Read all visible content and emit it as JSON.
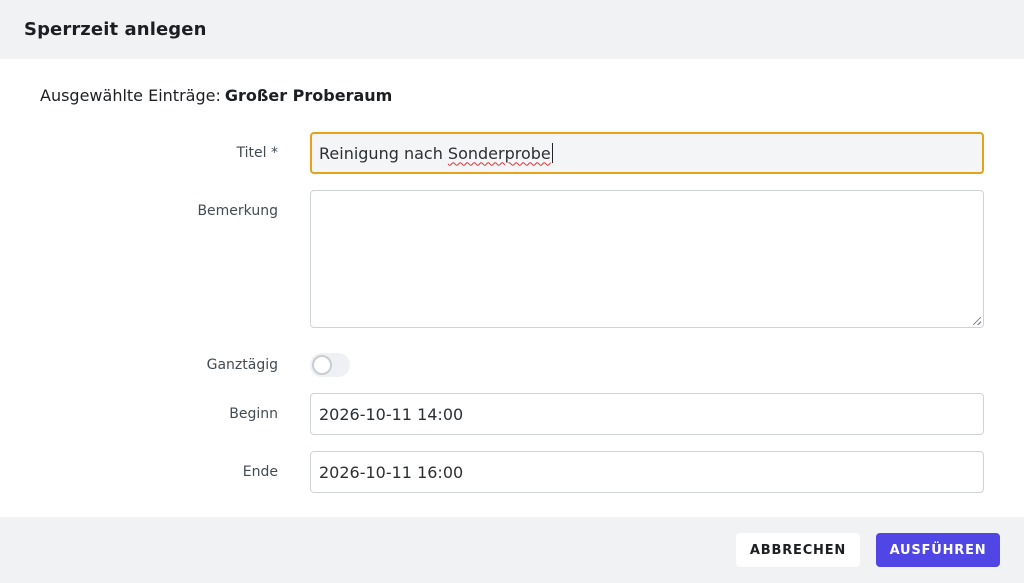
{
  "dialog": {
    "title": "Sperrzeit anlegen"
  },
  "selection": {
    "label": "Ausgewählte Einträge:",
    "value": "Großer Proberaum"
  },
  "form": {
    "title": {
      "label": "Titel *",
      "value_prefix": "Reinigung nach ",
      "value_misspelled": "Sonderprobe"
    },
    "remark": {
      "label": "Bemerkung",
      "value": ""
    },
    "all_day": {
      "label": "Ganztägig",
      "checked": false
    },
    "start": {
      "label": "Beginn",
      "value": "2026-10-11 14:00"
    },
    "end": {
      "label": "Ende",
      "value": "2026-10-11 16:00"
    }
  },
  "footer": {
    "cancel_label": "ABBRECHEN",
    "run_label": "AUSFÜHREN"
  },
  "colors": {
    "focus_border": "#e8a21a",
    "primary_button": "#4f46e5",
    "header_bg": "#f1f2f4"
  }
}
